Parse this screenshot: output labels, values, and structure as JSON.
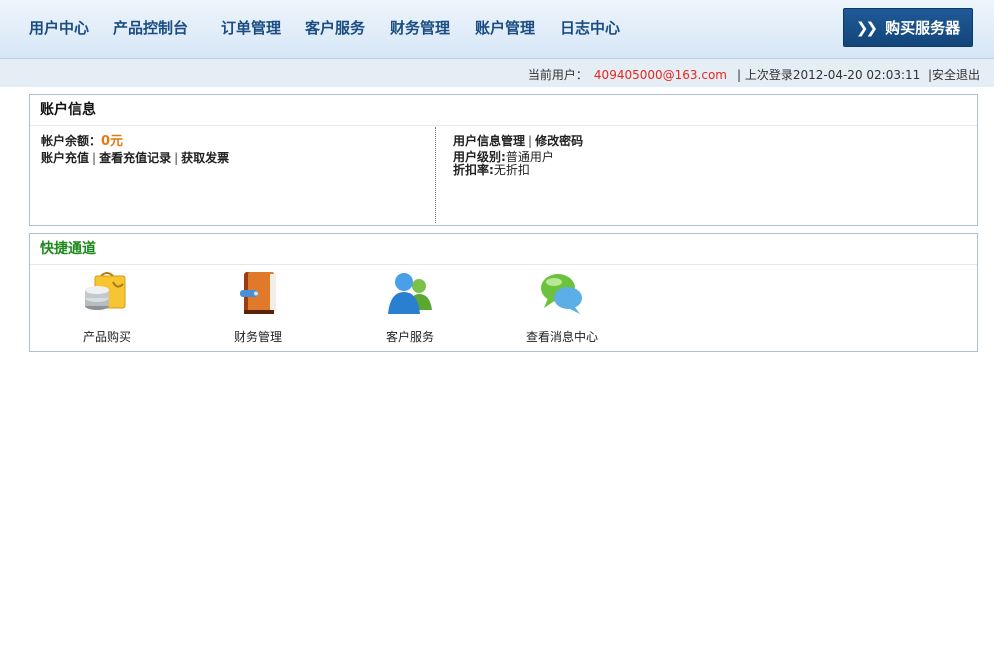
{
  "nav": {
    "items": [
      "用户中心",
      "产品控制台",
      "订单管理",
      "客户服务",
      "财务管理",
      "账户管理",
      "日志中心"
    ],
    "buy_button": "购买服务器"
  },
  "status": {
    "user_label": "当前用户：",
    "user_email": "409405000@163.com",
    "last_login": "| 上次登录2012-04-20 02:03:11",
    "logout": "安全退出"
  },
  "account": {
    "title": "账户信息",
    "balance_label": "帐户余额：",
    "balance_value": "0元",
    "links_left": [
      "账户充值",
      "查看充值记录",
      "获取发票"
    ],
    "links_right": [
      "用户信息管理",
      "修改密码"
    ],
    "level_label": "用户级别:",
    "level_value": "普通用户",
    "discount_label": "折扣率:",
    "discount_value": "无折扣"
  },
  "quick": {
    "title": "快捷通道",
    "items": [
      {
        "label": "产品购买",
        "icon": "shopping-bag-icon"
      },
      {
        "label": "财务管理",
        "icon": "ledger-book-icon"
      },
      {
        "label": "客户服务",
        "icon": "users-icon"
      },
      {
        "label": "查看消息中心",
        "icon": "chat-bubbles-icon"
      }
    ]
  },
  "colors": {
    "accent": "#1b4d82",
    "balance": "#e07a12",
    "email": "#e8261d",
    "quick_title": "#1c8a1c"
  }
}
